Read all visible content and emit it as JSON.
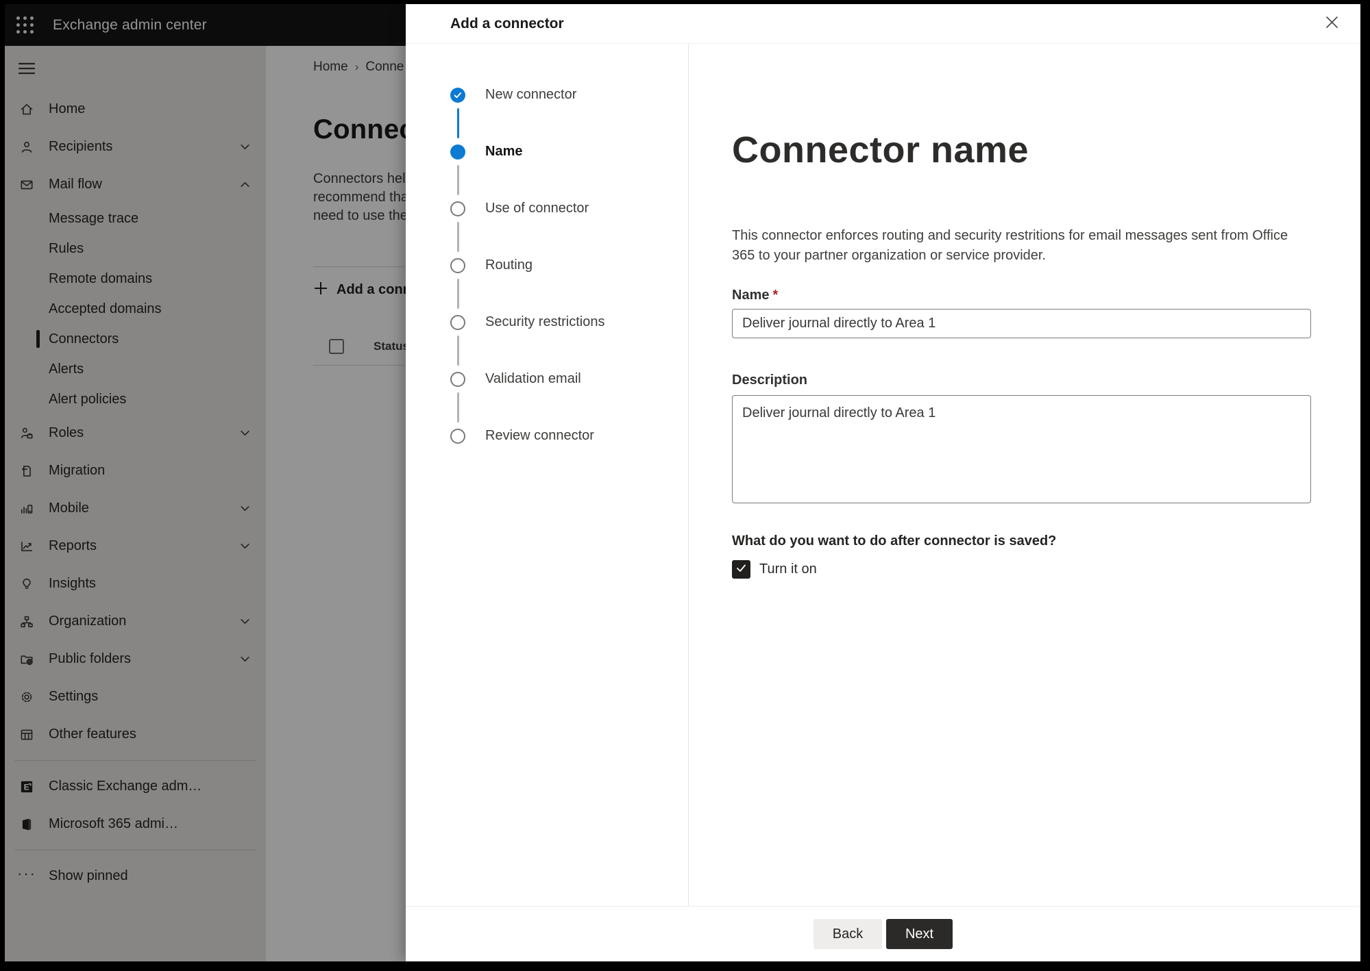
{
  "topbar": {
    "title": "Exchange admin center"
  },
  "sidebar": {
    "items": [
      {
        "label": "Home",
        "icon": "home-icon",
        "type": "top"
      },
      {
        "label": "Recipients",
        "icon": "person-icon",
        "type": "top",
        "chevron": "down"
      },
      {
        "label": "Mail flow",
        "icon": "mail-icon",
        "type": "top",
        "chevron": "up"
      },
      {
        "label": "Message trace",
        "type": "sub"
      },
      {
        "label": "Rules",
        "type": "sub"
      },
      {
        "label": "Remote domains",
        "type": "sub"
      },
      {
        "label": "Accepted domains",
        "type": "sub"
      },
      {
        "label": "Connectors",
        "type": "sub",
        "selected": true
      },
      {
        "label": "Alerts",
        "type": "sub"
      },
      {
        "label": "Alert policies",
        "type": "sub"
      },
      {
        "label": "Roles",
        "icon": "roles-icon",
        "type": "top",
        "chevron": "down"
      },
      {
        "label": "Migration",
        "icon": "migration-icon",
        "type": "top"
      },
      {
        "label": "Mobile",
        "icon": "mobile-icon",
        "type": "top",
        "chevron": "down"
      },
      {
        "label": "Reports",
        "icon": "reports-icon",
        "type": "top",
        "chevron": "down"
      },
      {
        "label": "Insights",
        "icon": "insights-icon",
        "type": "top"
      },
      {
        "label": "Organization",
        "icon": "organization-icon",
        "type": "top",
        "chevron": "down"
      },
      {
        "label": "Public folders",
        "icon": "public-folders-icon",
        "type": "top",
        "chevron": "down"
      },
      {
        "label": "Settings",
        "icon": "settings-icon",
        "type": "top"
      },
      {
        "label": "Other features",
        "icon": "other-features-icon",
        "type": "top"
      }
    ],
    "footer_items": [
      {
        "label": "Classic Exchange adm…",
        "icon": "classic-exchange-icon"
      },
      {
        "label": "Microsoft 365 admi…",
        "icon": "microsoft-365-icon"
      }
    ],
    "show_pinned": {
      "label": "Show pinned",
      "icon": "ellipsis-icon"
    }
  },
  "page": {
    "breadcrumb": {
      "home": "Home",
      "separator": "›",
      "current": "Conne"
    },
    "title": "Connec",
    "intro_lines": [
      "Connectors help",
      "recommend that",
      "need to use ther"
    ],
    "add_button": {
      "label": "Add a conn"
    },
    "table": {
      "status_header": "Status"
    }
  },
  "dialog": {
    "title": "Add a connector",
    "steps": [
      {
        "label": "New connector",
        "state": "completed"
      },
      {
        "label": "Name",
        "state": "current"
      },
      {
        "label": "Use of connector",
        "state": "upcoming"
      },
      {
        "label": "Routing",
        "state": "upcoming"
      },
      {
        "label": "Security restrictions",
        "state": "upcoming"
      },
      {
        "label": "Validation email",
        "state": "upcoming"
      },
      {
        "label": "Review connector",
        "state": "upcoming"
      }
    ],
    "content": {
      "heading": "Connector name",
      "description": "This connector enforces routing and security restritions for email messages sent from Office 365 to your partner organization or service provider.",
      "name_label": "Name",
      "required_marker": "*",
      "name_value": "Deliver journal directly to Area 1",
      "description_label": "Description",
      "description_value": "Deliver journal directly to Area 1",
      "after_save_question": "What do you want to do after connector is saved?",
      "turn_on_label": "Turn it on",
      "turn_on_checked": true
    },
    "footer": {
      "back": "Back",
      "next": "Next"
    }
  },
  "colors": {
    "accent": "#0b7bd4",
    "danger": "#a4262c",
    "next_button": "#2b2a28",
    "overlay": "rgba(0,0,0,0.42)"
  }
}
